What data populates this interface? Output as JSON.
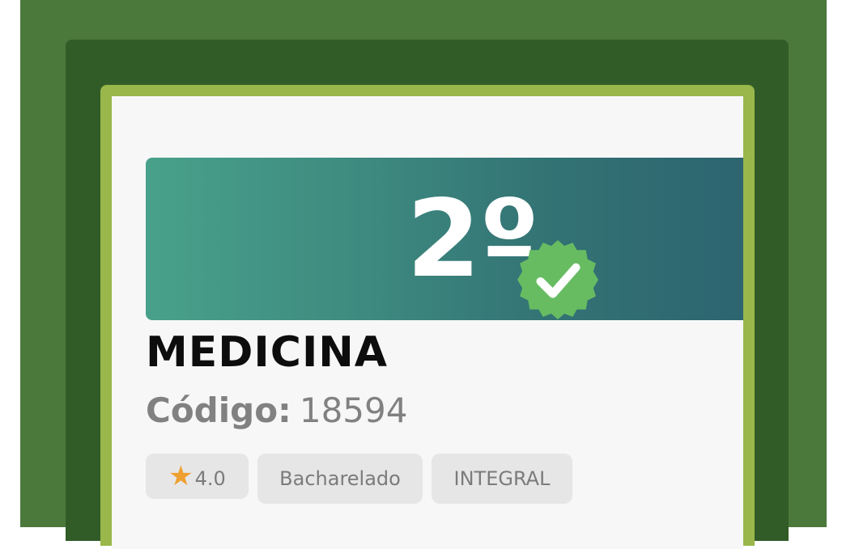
{
  "course": {
    "rank": "2º",
    "name": "MEDICINA",
    "code_label": "Código:",
    "code_value": "18594",
    "rating": "4.0",
    "degree": "Bacharelado",
    "shift": "INTEGRAL"
  },
  "icons": {
    "rating": "star-icon",
    "badge": "check-badge-icon"
  },
  "colors": {
    "outer_bg": "#4b793c",
    "panel_bg": "#325c27",
    "card_border": "#99b74a",
    "card_bg": "#f7f7f7",
    "banner_start": "#48a18a",
    "banner_end": "#2c6370",
    "badge_green": "#67bc62",
    "star": "#efa030"
  }
}
